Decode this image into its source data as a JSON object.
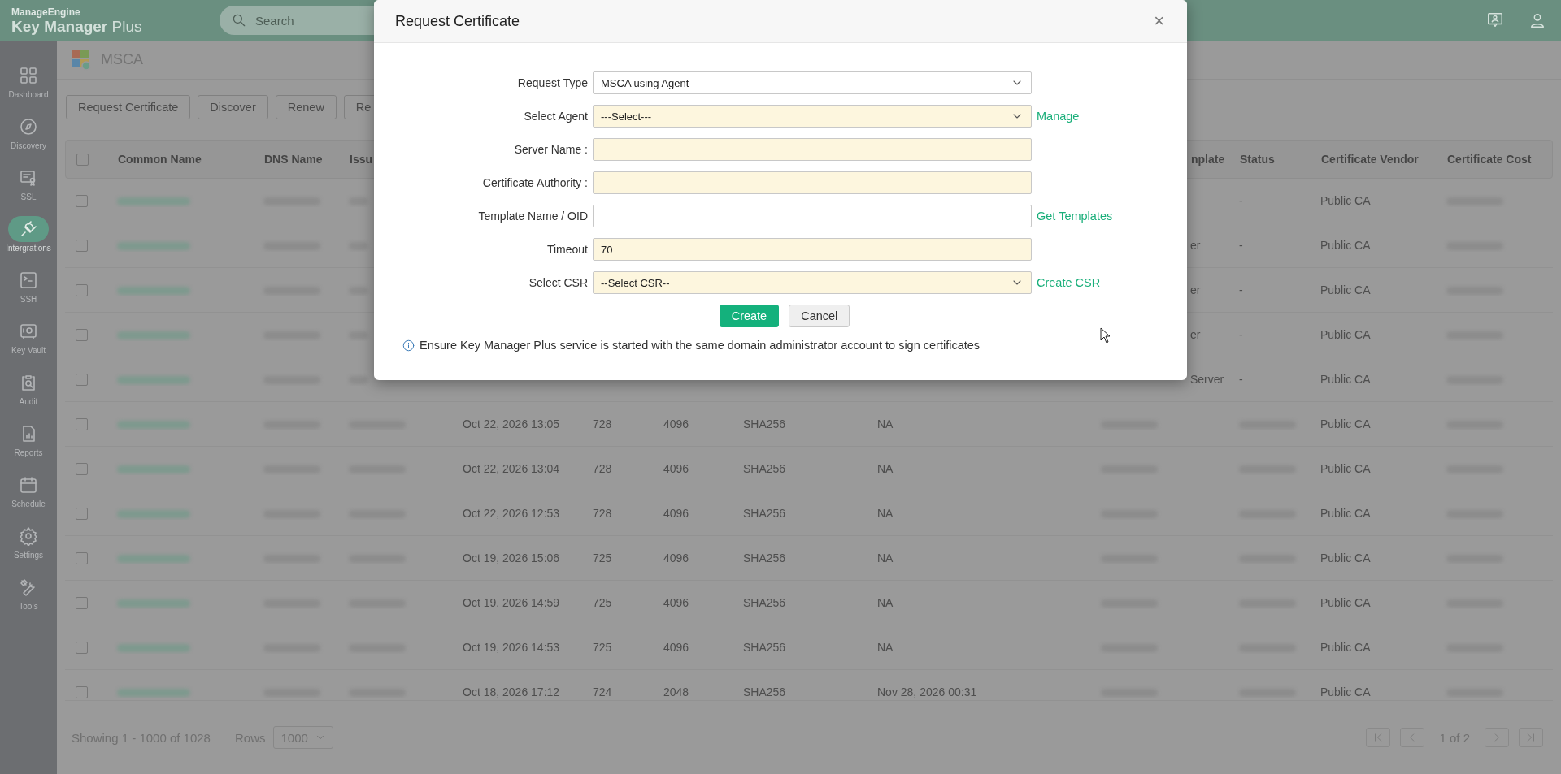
{
  "header": {
    "brand": "ManageEngine",
    "product": "**Key Manager** Plus",
    "search": {
      "placeholder": "Search"
    }
  },
  "sidebar": {
    "items": [
      {
        "label": "Dashboard",
        "selected": false
      },
      {
        "label": "Discovery",
        "selected": false
      },
      {
        "label": "SSL",
        "selected": false
      },
      {
        "label": "Intergrations",
        "selected": true
      },
      {
        "label": "SSH",
        "selected": false
      },
      {
        "label": "Key Vault",
        "selected": false
      },
      {
        "label": "Audit",
        "selected": false
      },
      {
        "label": "Reports",
        "selected": false
      },
      {
        "label": "Schedule",
        "selected": false
      },
      {
        "label": "Settings",
        "selected": false
      },
      {
        "label": "Tools",
        "selected": false
      }
    ]
  },
  "page": {
    "title": "MSCA"
  },
  "toolbar": {
    "buttons": [
      "Request Certificate",
      "Discover",
      "Renew",
      "Re"
    ]
  },
  "table": {
    "all_checked": false,
    "columns": [
      "Common Name",
      "DNS Name",
      "Issu",
      null,
      null,
      null,
      null,
      null,
      "nplate",
      "Status",
      "Certificate Vendor",
      "Certificate Cost"
    ],
    "rows": [
      {
        "checked": false,
        "cells": [
          {
            "kind": "blurred"
          },
          {
            "kind": "blurred"
          },
          {
            "kind": "blurred"
          },
          null,
          null,
          null,
          null,
          null,
          null,
          "-",
          "Public CA",
          {
            "kind": "blurred"
          }
        ]
      },
      {
        "checked": false,
        "cells": [
          {
            "kind": "blurred"
          },
          {
            "kind": "blurred"
          },
          {
            "kind": "blurred"
          },
          null,
          null,
          null,
          null,
          null,
          "er",
          "-",
          "Public CA",
          {
            "kind": "blurred"
          }
        ]
      },
      {
        "checked": false,
        "cells": [
          {
            "kind": "blurred"
          },
          {
            "kind": "blurred"
          },
          {
            "kind": "blurred"
          },
          null,
          null,
          null,
          null,
          null,
          "er",
          "-",
          "Public CA",
          {
            "kind": "blurred"
          }
        ]
      },
      {
        "checked": false,
        "cells": [
          {
            "kind": "blurred"
          },
          {
            "kind": "blurred"
          },
          {
            "kind": "blurred"
          },
          null,
          null,
          null,
          null,
          null,
          "er",
          "-",
          "Public CA",
          {
            "kind": "blurred"
          }
        ]
      },
      {
        "checked": false,
        "cells": [
          {
            "kind": "blurred"
          },
          {
            "kind": "blurred"
          },
          {
            "kind": "blurred"
          },
          null,
          null,
          null,
          null,
          null,
          "Server",
          "-",
          "Public CA",
          {
            "kind": "blurred"
          }
        ]
      },
      {
        "checked": false,
        "cells": [
          {
            "kind": "blurred"
          },
          {
            "kind": "blurred"
          },
          {
            "kind": "blurred"
          },
          "Oct 22, 2026 13:05",
          "728",
          "4096",
          "SHA256",
          "NA",
          {
            "kind": "blurred"
          },
          {
            "kind": "blurred"
          },
          "Public CA",
          {
            "kind": "blurred"
          }
        ]
      },
      {
        "checked": false,
        "cells": [
          {
            "kind": "blurred"
          },
          {
            "kind": "blurred"
          },
          {
            "kind": "blurred"
          },
          "Oct 22, 2026 13:04",
          "728",
          "4096",
          "SHA256",
          "NA",
          {
            "kind": "blurred"
          },
          {
            "kind": "blurred"
          },
          "Public CA",
          {
            "kind": "blurred"
          }
        ]
      },
      {
        "checked": false,
        "cells": [
          {
            "kind": "blurred"
          },
          {
            "kind": "blurred"
          },
          {
            "kind": "blurred"
          },
          "Oct 22, 2026 12:53",
          "728",
          "4096",
          "SHA256",
          "NA",
          {
            "kind": "blurred"
          },
          {
            "kind": "blurred"
          },
          "Public CA",
          {
            "kind": "blurred"
          }
        ]
      },
      {
        "checked": false,
        "cells": [
          {
            "kind": "blurred"
          },
          {
            "kind": "blurred"
          },
          {
            "kind": "blurred"
          },
          "Oct 19, 2026 15:06",
          "725",
          "4096",
          "SHA256",
          "NA",
          {
            "kind": "blurred"
          },
          {
            "kind": "blurred"
          },
          "Public CA",
          {
            "kind": "blurred"
          }
        ]
      },
      {
        "checked": false,
        "cells": [
          {
            "kind": "blurred"
          },
          {
            "kind": "blurred"
          },
          {
            "kind": "blurred"
          },
          "Oct 19, 2026 14:59",
          "725",
          "4096",
          "SHA256",
          "NA",
          {
            "kind": "blurred"
          },
          {
            "kind": "blurred"
          },
          "Public CA",
          {
            "kind": "blurred"
          }
        ]
      },
      {
        "checked": false,
        "cells": [
          {
            "kind": "blurred"
          },
          {
            "kind": "blurred"
          },
          {
            "kind": "blurred"
          },
          "Oct 19, 2026 14:53",
          "725",
          "4096",
          "SHA256",
          "NA",
          {
            "kind": "blurred"
          },
          {
            "kind": "blurred"
          },
          "Public CA",
          {
            "kind": "blurred"
          }
        ]
      },
      {
        "checked": false,
        "cells": [
          {
            "kind": "blurred"
          },
          {
            "kind": "blurred"
          },
          {
            "kind": "blurred"
          },
          "Oct 18, 2026 17:12",
          "724",
          "2048",
          "SHA256",
          "Nov 28, 2026 00:31",
          {
            "kind": "blurred"
          },
          {
            "kind": "blurred"
          },
          "Public CA",
          {
            "kind": "blurred"
          }
        ]
      }
    ]
  },
  "footer": {
    "summary": "Showing 1 - 1000 of 1028",
    "rows_label": "Rows",
    "rows_value": "1000",
    "page": "1 of 2"
  },
  "dialog": {
    "title": "Request Certificate",
    "close": "×",
    "fields": [
      {
        "label": "Request Type",
        "kind": "select",
        "value": "MSCA using Agent",
        "required": false
      },
      {
        "label": "Select Agent",
        "kind": "select",
        "value": "---Select---",
        "required": true,
        "link": "Manage"
      },
      {
        "label": "Server Name :",
        "kind": "text",
        "required": true
      },
      {
        "label": "Certificate Authority :",
        "kind": "text",
        "required": true
      },
      {
        "label": "Template Name / OID",
        "kind": "text",
        "required": false,
        "link": "Get Templates"
      },
      {
        "label": "Timeout",
        "kind": "text",
        "value": "70",
        "required": true
      },
      {
        "label": "Select CSR",
        "kind": "select",
        "value": "--Select CSR--",
        "required": true,
        "link": "Create CSR"
      }
    ],
    "buttons": [
      {
        "label": "Create",
        "primary": true
      },
      {
        "label": "Cancel",
        "primary": false
      }
    ],
    "note": "Ensure Key Manager Plus service is started with the same domain administrator account to sign certificates"
  }
}
